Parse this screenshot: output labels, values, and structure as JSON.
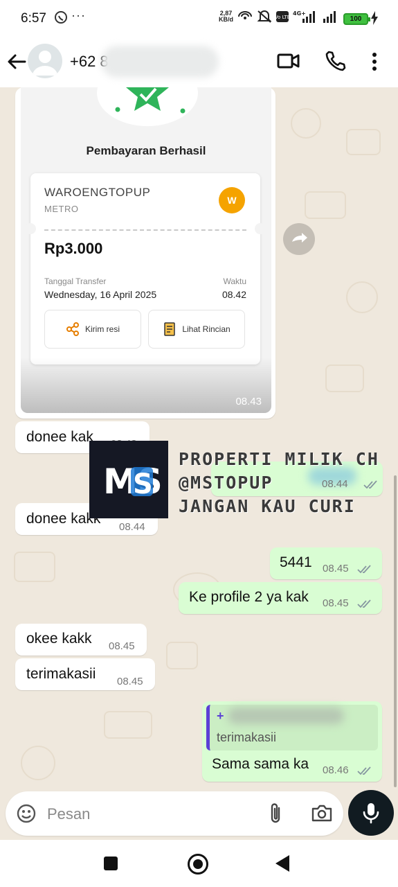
{
  "status_bar": {
    "time": "6:57",
    "more": "···",
    "net_speed_value": "2,87",
    "net_speed_unit": "KB/d",
    "volte_label": "Vo LTE",
    "network_label": "4G+",
    "battery": "100"
  },
  "header": {
    "contact_prefix": "+62 8",
    "icons": [
      "back-arrow-icon",
      "video-call-icon",
      "voice-call-icon",
      "more-vert-icon"
    ]
  },
  "receipt": {
    "title": "Pembayaran Berhasil",
    "merchant": "WAROENGTOPUP",
    "merchant_sub": "METRO",
    "merchant_initial": "W",
    "amount": "Rp3.000",
    "date_label": "Tanggal Transfer",
    "date_value": "Wednesday, 16 April 2025",
    "time_label": "Waktu",
    "time_value": "08.42",
    "btn_send": "Kirim resi",
    "btn_detail": "Lihat Rincian",
    "timestamp": "08.43"
  },
  "watermark": {
    "logo": "MS",
    "lines": [
      "PROPERTI MILIK CH",
      "@MSTOPUP",
      "JANGAN KAU CURI"
    ]
  },
  "messages": [
    {
      "id": "m1",
      "dir": "in",
      "text": "donee kak",
      "time": "08.43"
    },
    {
      "id": "m2",
      "dir": "out",
      "text": "",
      "time": "08.44"
    },
    {
      "id": "m3",
      "dir": "in",
      "text": "donee kakk",
      "time": "08.44"
    },
    {
      "id": "m4",
      "dir": "out",
      "text": "5441",
      "time": "08.45"
    },
    {
      "id": "m5",
      "dir": "out",
      "text": "Ke profile 2 ya kak",
      "time": "08.45"
    },
    {
      "id": "m6",
      "dir": "in",
      "text": "okee kakk",
      "time": "08.45"
    },
    {
      "id": "m7",
      "dir": "in",
      "text": "terimakasii",
      "time": "08.45"
    },
    {
      "id": "m8",
      "dir": "out",
      "text": "Sama sama ka",
      "time": "08.46",
      "quote_sender": "+",
      "quote_text": "terimakasii"
    }
  ],
  "input": {
    "placeholder": "Pesan"
  },
  "colors": {
    "chat_bg": "#efe8dd",
    "outgoing_bubble": "#d9fdd3",
    "incoming_bubble": "#ffffff",
    "quote_bar": "#5b3fd6",
    "mic_button": "#111b21"
  }
}
